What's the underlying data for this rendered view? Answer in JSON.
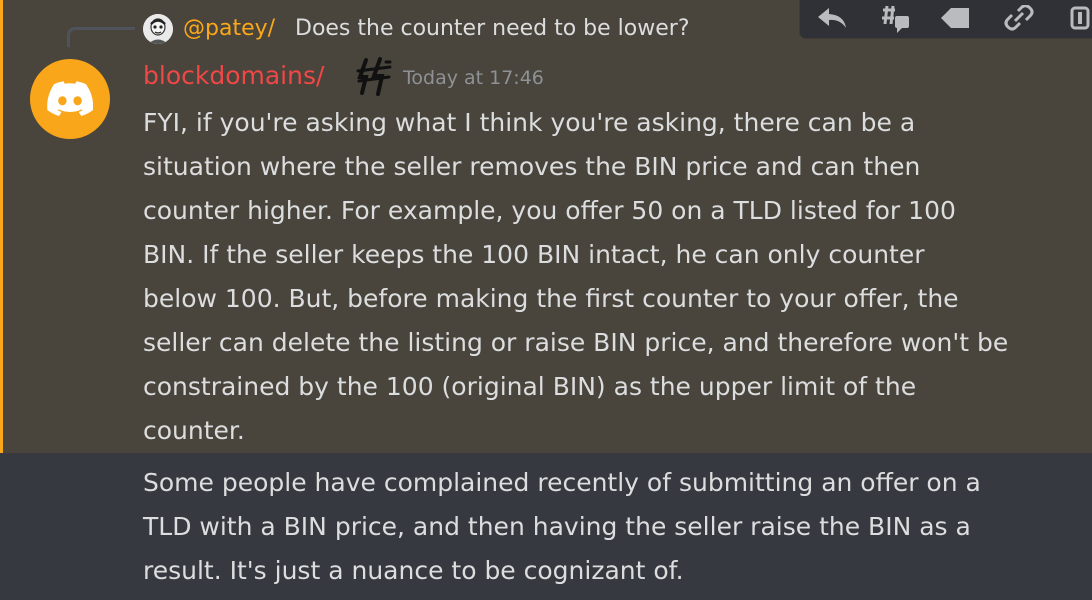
{
  "colors": {
    "mention_background": "#49443c",
    "mention_border": "#faa81a",
    "chat_background": "#36393f",
    "username_color": "#f04747",
    "reply_author_color": "#faa81a",
    "text_color": "#dcddde",
    "timestamp_color": "#8e9297",
    "avatar_color": "#faa61a"
  },
  "reply": {
    "author": "@patey/",
    "content": "Does the counter need to be lower?"
  },
  "message": {
    "username": "blockdomains/",
    "timestamp": "Today at 17:46",
    "avatar_icon": "discord-logo-icon",
    "badge_icon": "brand-badge-icon",
    "lines": [
      "FYI, if you're asking what I think you're asking, there can be a",
      "situation where the seller removes the BIN price and can then",
      "counter higher. For example, you offer 50 on a TLD listed for 100",
      "BIN. If the seller keeps the 100 BIN intact, he can only counter",
      "below 100. But, before making the first counter to your offer, the",
      "seller can delete the listing or raise BIN price, and therefore won't be",
      "constrained by the 100 (original BIN) as the upper limit of the",
      "counter."
    ]
  },
  "followup": {
    "lines": [
      "Some people have complained recently of submitting an offer on a",
      "TLD with a BIN price, and then having the seller raise the BIN as a",
      "result. It's just a nuance to be cognizant of."
    ]
  },
  "toolbar": {
    "icons": [
      "reply-icon",
      "create-thread-icon",
      "mark-unread-icon",
      "copy-link-icon",
      "more-icon"
    ]
  }
}
